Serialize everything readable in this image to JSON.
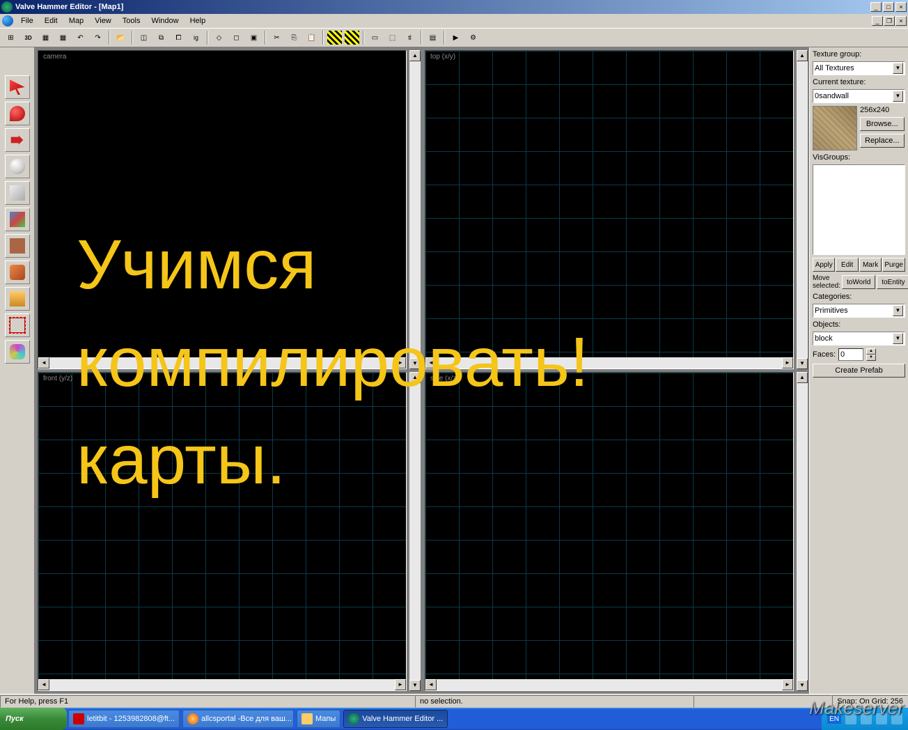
{
  "title": "Valve Hammer Editor - [Map1]",
  "menus": [
    "File",
    "Edit",
    "Map",
    "View",
    "Tools",
    "Window",
    "Help"
  ],
  "viewports": {
    "tl": "camera",
    "tr": "top (x/y)",
    "bl": "front (y/z)",
    "br": "side (x/z)"
  },
  "panel": {
    "texture_group_label": "Texture group:",
    "texture_group_value": "All Textures",
    "current_texture_label": "Current texture:",
    "current_texture_value": "0sandwall",
    "texture_size": "256x240",
    "browse": "Browse...",
    "replace": "Replace...",
    "visgroups_label": "VisGroups:",
    "apply": "Apply",
    "edit": "Edit",
    "mark": "Mark",
    "purge": "Purge",
    "move_selected": "Move\nselected:",
    "to_world": "toWorld",
    "to_entity": "toEntity",
    "categories_label": "Categories:",
    "categories_value": "Primitives",
    "objects_label": "Objects:",
    "objects_value": "block",
    "faces_label": "Faces:",
    "faces_value": "0",
    "create_prefab": "Create Prefab"
  },
  "status": {
    "help": "For Help, press F1",
    "selection": "no selection.",
    "snap": "Snap: On Grid: 256"
  },
  "taskbar": {
    "start": "Пуск",
    "items": [
      "letitbit - 1253982808@ft...",
      "allcsportal -Все для ваш...",
      "Мапы",
      "Valve Hammer Editor ..."
    ],
    "lang": "EN"
  },
  "overlay": "Учимся\nкомпилировать!\nкарты.",
  "watermark": "Makeserver"
}
